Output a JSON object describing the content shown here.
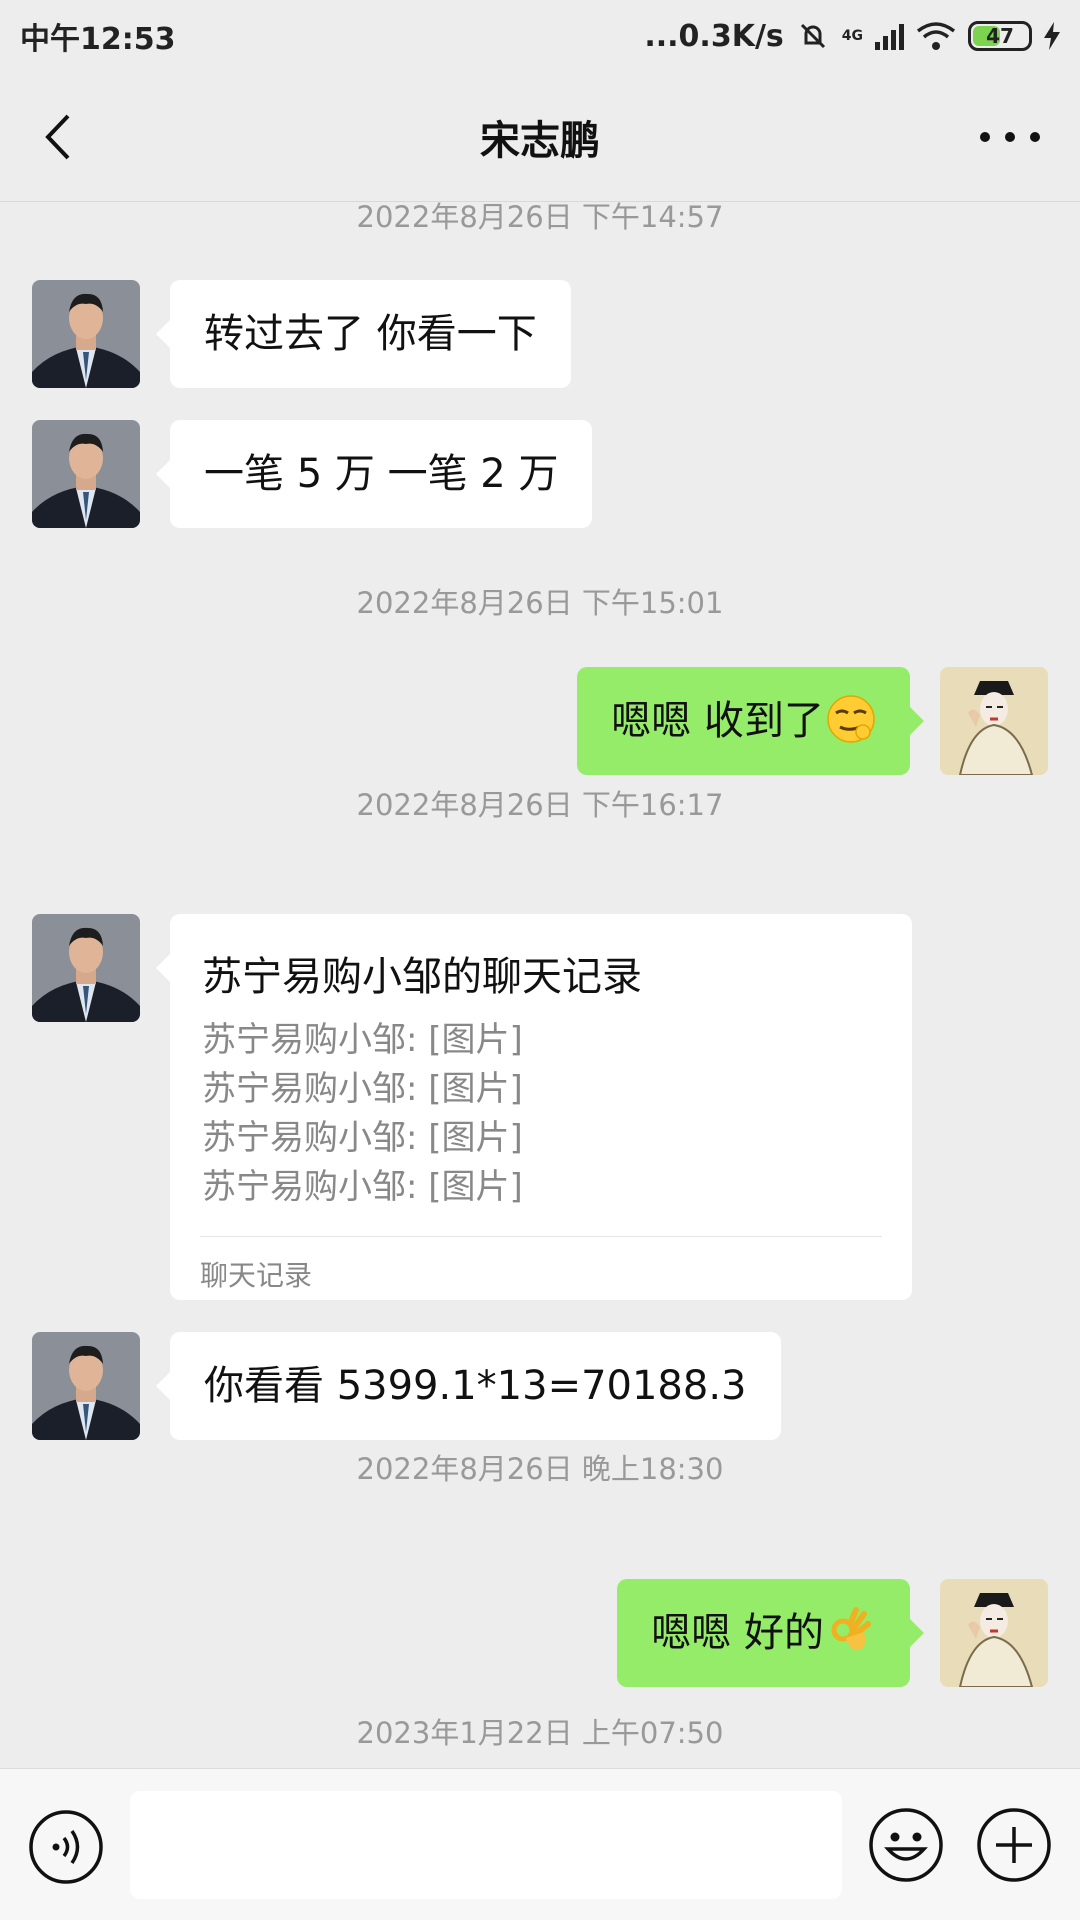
{
  "status_bar": {
    "time": "中午12:53",
    "network_speed": "...0.3K/s",
    "network_type": "4G",
    "battery": "47"
  },
  "header": {
    "title": "宋志鹏"
  },
  "messages": {
    "t1": "2022年8月26日 下午14:57",
    "m1": "转过去了  你看一下",
    "m2": "一笔 5 万  一笔 2 万",
    "t2": "2022年8月26日 下午15:01",
    "m3": "嗯嗯  收到了",
    "t3": "2022年8月26日 下午16:17",
    "record": {
      "title": "苏宁易购小邹的聊天记录",
      "lines": [
        "苏宁易购小邹: [图片]",
        "苏宁易购小邹: [图片]",
        "苏宁易购小邹: [图片]",
        "苏宁易购小邹: [图片]"
      ],
      "footer": "聊天记录"
    },
    "m4": "你看看 5399.1*13=70188.3",
    "t4": "2022年8月26日 晚上18:30",
    "m5": "嗯嗯  好的",
    "t5": "2023年1月22日 上午07:50"
  },
  "icons": {
    "back": "back-arrow-icon",
    "more": "more-icon",
    "voice": "voice-icon",
    "emoji": "emoji-icon",
    "plus": "plus-icon"
  },
  "colors": {
    "background": "#ededed",
    "outgoing_bubble": "#95ec69",
    "incoming_bubble": "#ffffff"
  }
}
